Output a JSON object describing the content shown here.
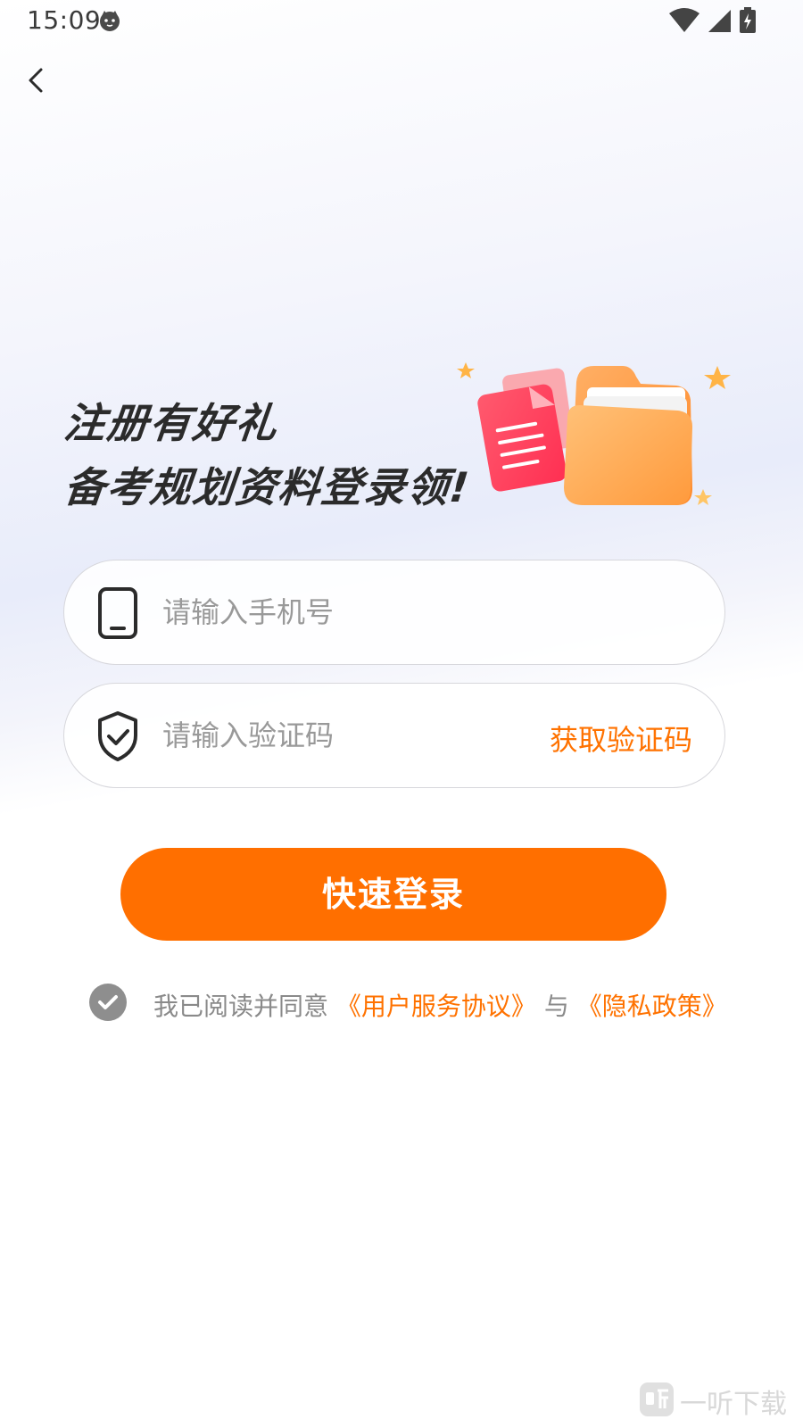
{
  "status_bar": {
    "time": "15:09"
  },
  "headline": {
    "line1": "注册有好礼",
    "line2": "备考规划资料登录领!"
  },
  "phone_field": {
    "placeholder": "请输入手机号"
  },
  "code_field": {
    "placeholder": "请输入验证码",
    "get_code_label": "获取验证码"
  },
  "login_button": {
    "label": "快速登录"
  },
  "agreement": {
    "prefix": "我已阅读并同意",
    "terms_link": "《用户服务协议》",
    "conjunction": "与",
    "privacy_link": "《隐私政策》",
    "checked": true
  },
  "watermark": {
    "text": "一听下载"
  },
  "colors": {
    "accent": "#ff6f00",
    "link": "#ff7200",
    "placeholder": "#999999"
  },
  "icons": [
    "wifi-icon",
    "signal-icon",
    "battery-charging-icon",
    "back-chevron-icon",
    "phone-icon",
    "shield-check-icon",
    "check-icon",
    "folder-illustration"
  ]
}
